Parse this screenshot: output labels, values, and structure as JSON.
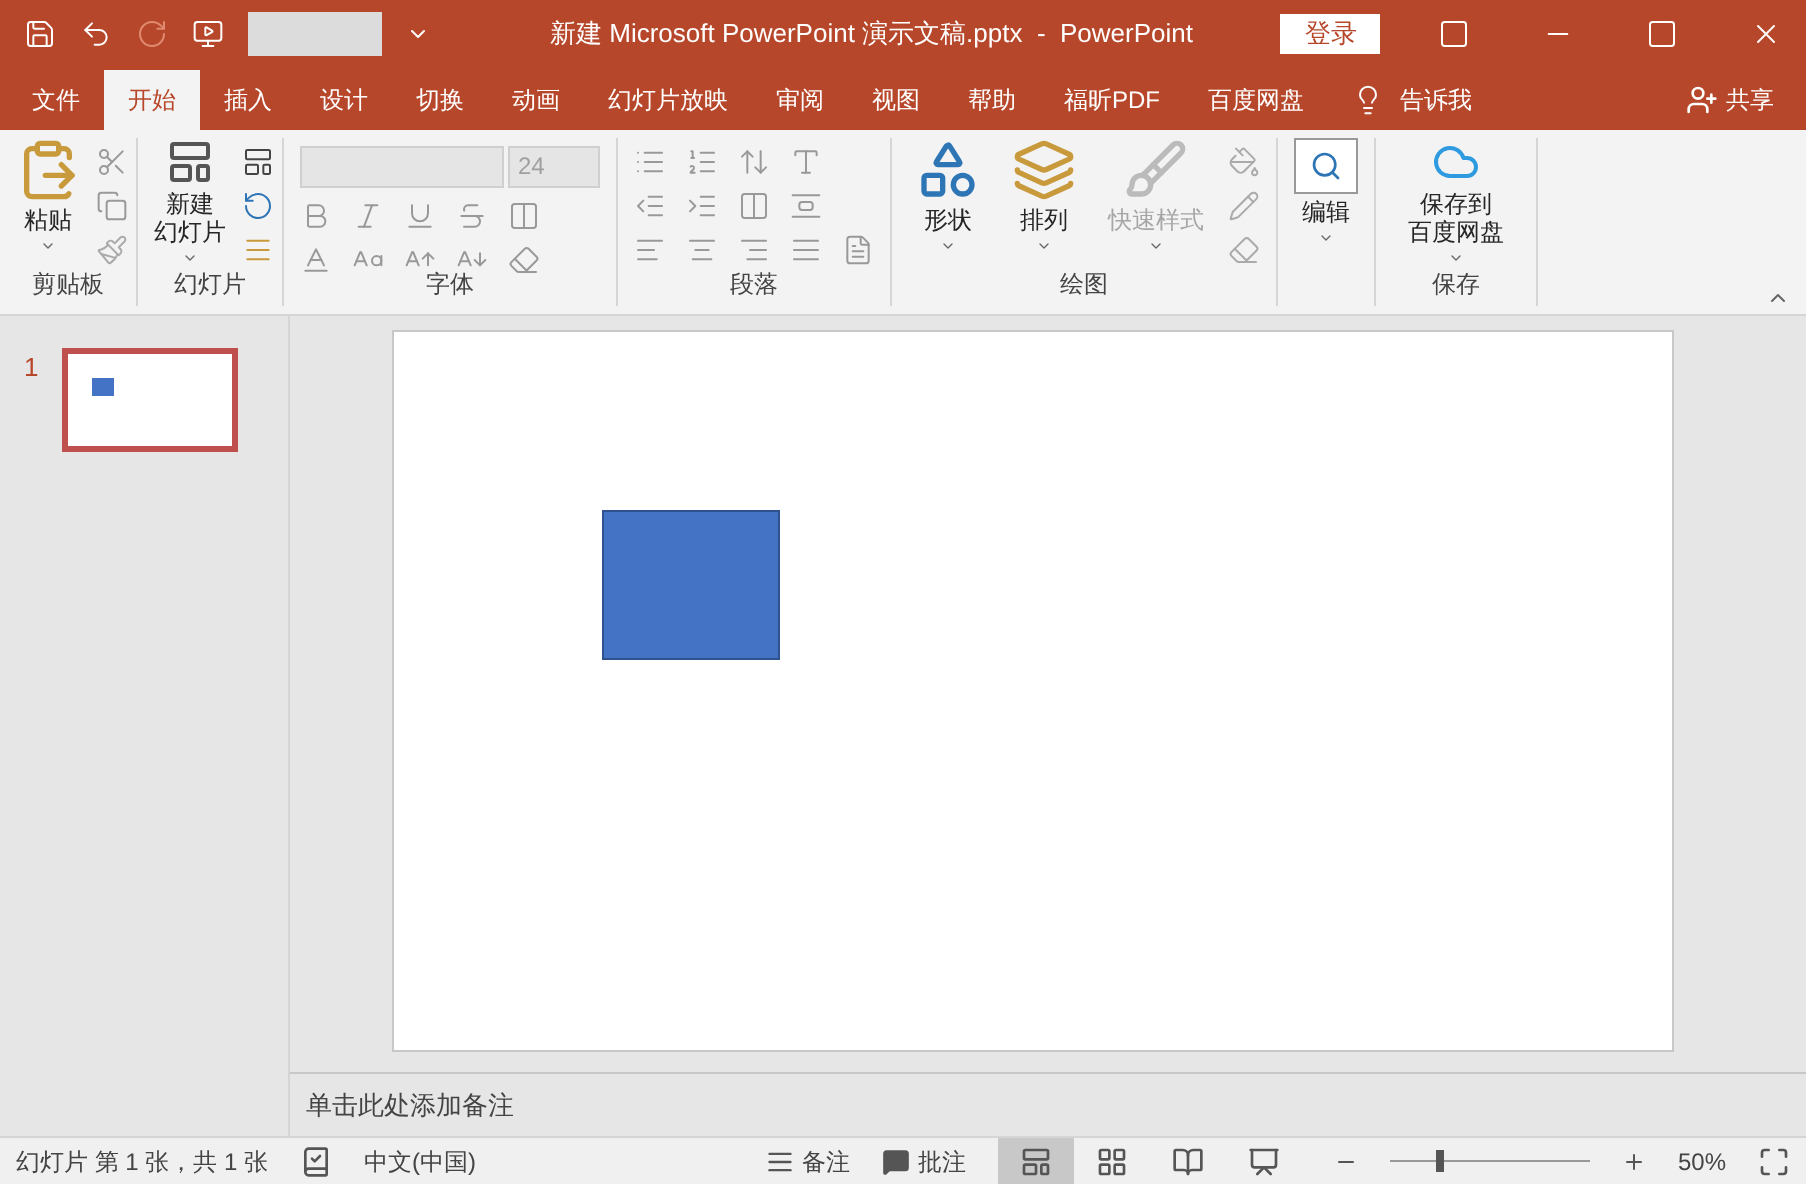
{
  "title_bar": {
    "title": "新建 Microsoft PowerPoint 演示文稿.pptx  -  PowerPoint",
    "login": "登录"
  },
  "tabs": [
    {
      "label": "文件",
      "selected": false
    },
    {
      "label": "开始",
      "selected": true
    },
    {
      "label": "插入",
      "selected": false
    },
    {
      "label": "设计",
      "selected": false
    },
    {
      "label": "切换",
      "selected": false
    },
    {
      "label": "动画",
      "selected": false
    },
    {
      "label": "幻灯片放映",
      "selected": false
    },
    {
      "label": "审阅",
      "selected": false
    },
    {
      "label": "视图",
      "selected": false
    },
    {
      "label": "帮助",
      "selected": false
    },
    {
      "label": "福昕PDF",
      "selected": false
    },
    {
      "label": "百度网盘",
      "selected": false
    }
  ],
  "tell_me": "告诉我",
  "share": "共享",
  "ribbon": [
    {
      "kind": "clipboard",
      "label": "剪贴板",
      "buttons": [
        {
          "label": "粘贴",
          "disabled": false
        }
      ]
    },
    {
      "kind": "slides",
      "label": "幻灯片",
      "buttons": [
        {
          "label_lines": [
            "新建",
            "幻灯片"
          ],
          "disabled": false
        }
      ]
    },
    {
      "kind": "font",
      "label": "字体",
      "font_size": "24"
    },
    {
      "kind": "paragraph",
      "label": "段落"
    },
    {
      "kind": "drawing",
      "label": "绘图",
      "buttons": [
        {
          "label": "形状",
          "disabled": false
        },
        {
          "label": "排列",
          "disabled": false
        },
        {
          "label": "快速样式",
          "disabled": true
        }
      ]
    },
    {
      "kind": "editing",
      "buttons": [
        {
          "label": "编辑",
          "disabled": false
        }
      ]
    },
    {
      "kind": "save",
      "label": "保存",
      "buttons": [
        {
          "label_lines": [
            "保存到",
            "百度网盘"
          ],
          "disabled": false
        }
      ]
    }
  ],
  "thumbnails": [
    {
      "number": "1",
      "selected": true
    }
  ],
  "slide": {
    "shapes": [
      {
        "kind": "rectangle"
      }
    ]
  },
  "notes_placeholder": "单击此处添加备注",
  "status_bar": {
    "slide_info": "幻灯片 第 1 张，共 1 张",
    "language": "中文(中国)",
    "notes": "备注",
    "comments": "批注",
    "views": [
      {
        "kind": "normal",
        "selected": true
      },
      {
        "kind": "sorter",
        "selected": false
      },
      {
        "kind": "reading",
        "selected": false
      },
      {
        "kind": "slideshow",
        "selected": false
      }
    ],
    "zoom": {
      "level": 0.25,
      "reading": "50%"
    }
  }
}
